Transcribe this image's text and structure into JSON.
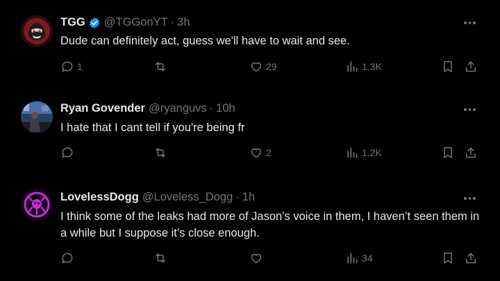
{
  "colors": {
    "background": "#000000",
    "text": "#e7e9ea",
    "muted": "#71767b",
    "verified": "#1d9bf0"
  },
  "tweets": [
    {
      "name": "TGG",
      "verified": true,
      "handle": "@TGGonYT",
      "time": "3h",
      "avatar_icon": "gorilla-logo-icon",
      "text": "Dude can definitely act, guess we'll have to wait and see.",
      "replies": "1",
      "retweets": "",
      "likes": "29",
      "views": "1.3K"
    },
    {
      "name": "Ryan Govender",
      "verified": false,
      "handle": "@ryanguvs",
      "time": "10h",
      "avatar_icon": "person-photo-icon",
      "text": "I hate that I cant tell if you're being fr",
      "replies": "",
      "retweets": "",
      "likes": "2",
      "views": "1.2K"
    },
    {
      "name": "LovelessDogg",
      "verified": false,
      "handle": "@Loveless_Dogg",
      "time": "1h",
      "avatar_icon": "hydra-emblem-icon",
      "text": "I think some of the leaks had more of Jason’s voice in them, I haven’t seen them in a while but I suppose it’s close enough.",
      "replies": "",
      "retweets": "",
      "likes": "",
      "views": "34"
    }
  ]
}
